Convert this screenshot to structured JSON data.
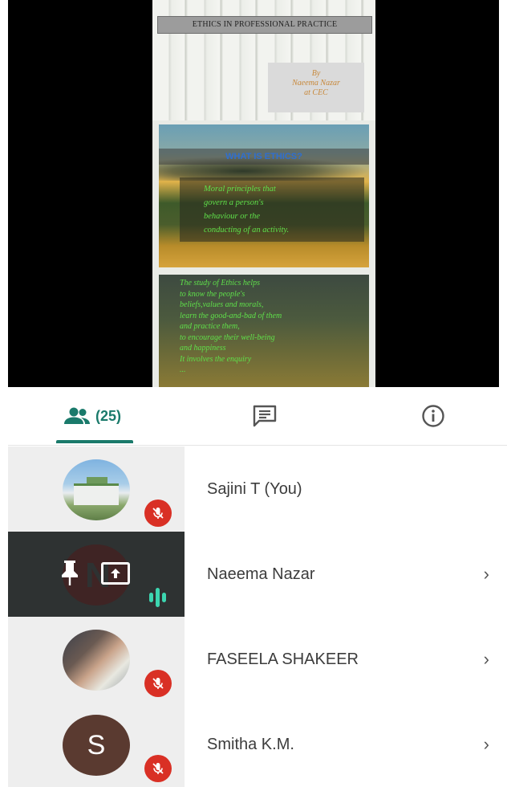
{
  "presentation": {
    "title": "ETHICS IN PROFESSIONAL PRACTICE",
    "byline": "By\nNaeema Nazar\nat CEC",
    "card1_heading": "WHAT IS ETHICS?",
    "card1_body": "Moral principles that\ngovern a person's\nbehaviour or the\nconducting of an activity.",
    "card2_body": "The study of Ethics helps\nto know the people's\nbeliefs,values and morals,\nlearn the good-and-bad of them\nand practice them,\nto encourage their well-being\nand happiness\nIt involves the enquiry\n..."
  },
  "tabs": {
    "people_count": "(25)",
    "people_icon": "people-icon",
    "chat_icon": "chat-icon",
    "info_icon": "info-icon",
    "accent_color": "#1a7a6b"
  },
  "participants": [
    {
      "name": "Sajini T (You)",
      "muted": true,
      "avatar": "photo"
    },
    {
      "name": "Naeema Nazar",
      "presenting": true,
      "pinned": true,
      "speaking": true,
      "avatar_initial": "N"
    },
    {
      "name": "FASEELA SHAKEER",
      "muted": true,
      "avatar": "photo"
    },
    {
      "name": "Smitha K.M.",
      "muted": true,
      "avatar_initial": "S"
    }
  ],
  "chevron": "›"
}
